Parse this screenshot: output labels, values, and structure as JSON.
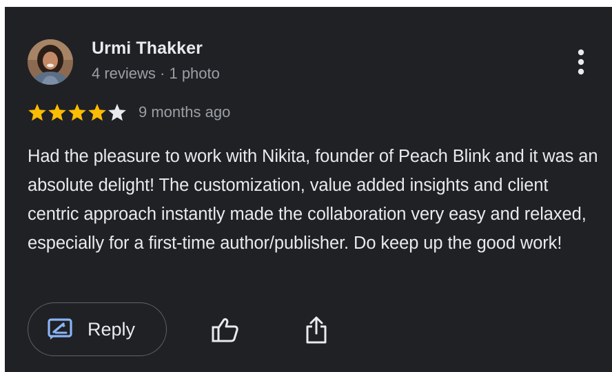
{
  "review": {
    "reviewer_name": "Urmi Thakker",
    "reviewer_meta": "4 reviews · 1 photo",
    "rating": 4,
    "max_rating": 5,
    "time_ago": "9 months ago",
    "text": "Had the pleasure to work with Nikita, founder of Peach Blink and it was an absolute delight! The customization, value added insights and client centric approach instantly made the collaboration very easy and relaxed, especially for a first-time author/publisher. Do keep up the good work!"
  },
  "actions": {
    "reply_label": "Reply",
    "reply_icon": "reply-icon",
    "like_icon": "thumbs-up-icon",
    "share_icon": "share-icon",
    "more_icon": "more-vert-icon"
  },
  "colors": {
    "background": "#202124",
    "primary_text": "#e8eaed",
    "secondary_text": "#9aa0a6",
    "star_filled": "#fbbc04",
    "star_empty": "#e8eaed",
    "accent_icon": "#8ab4f8",
    "outline": "#5f6368"
  }
}
